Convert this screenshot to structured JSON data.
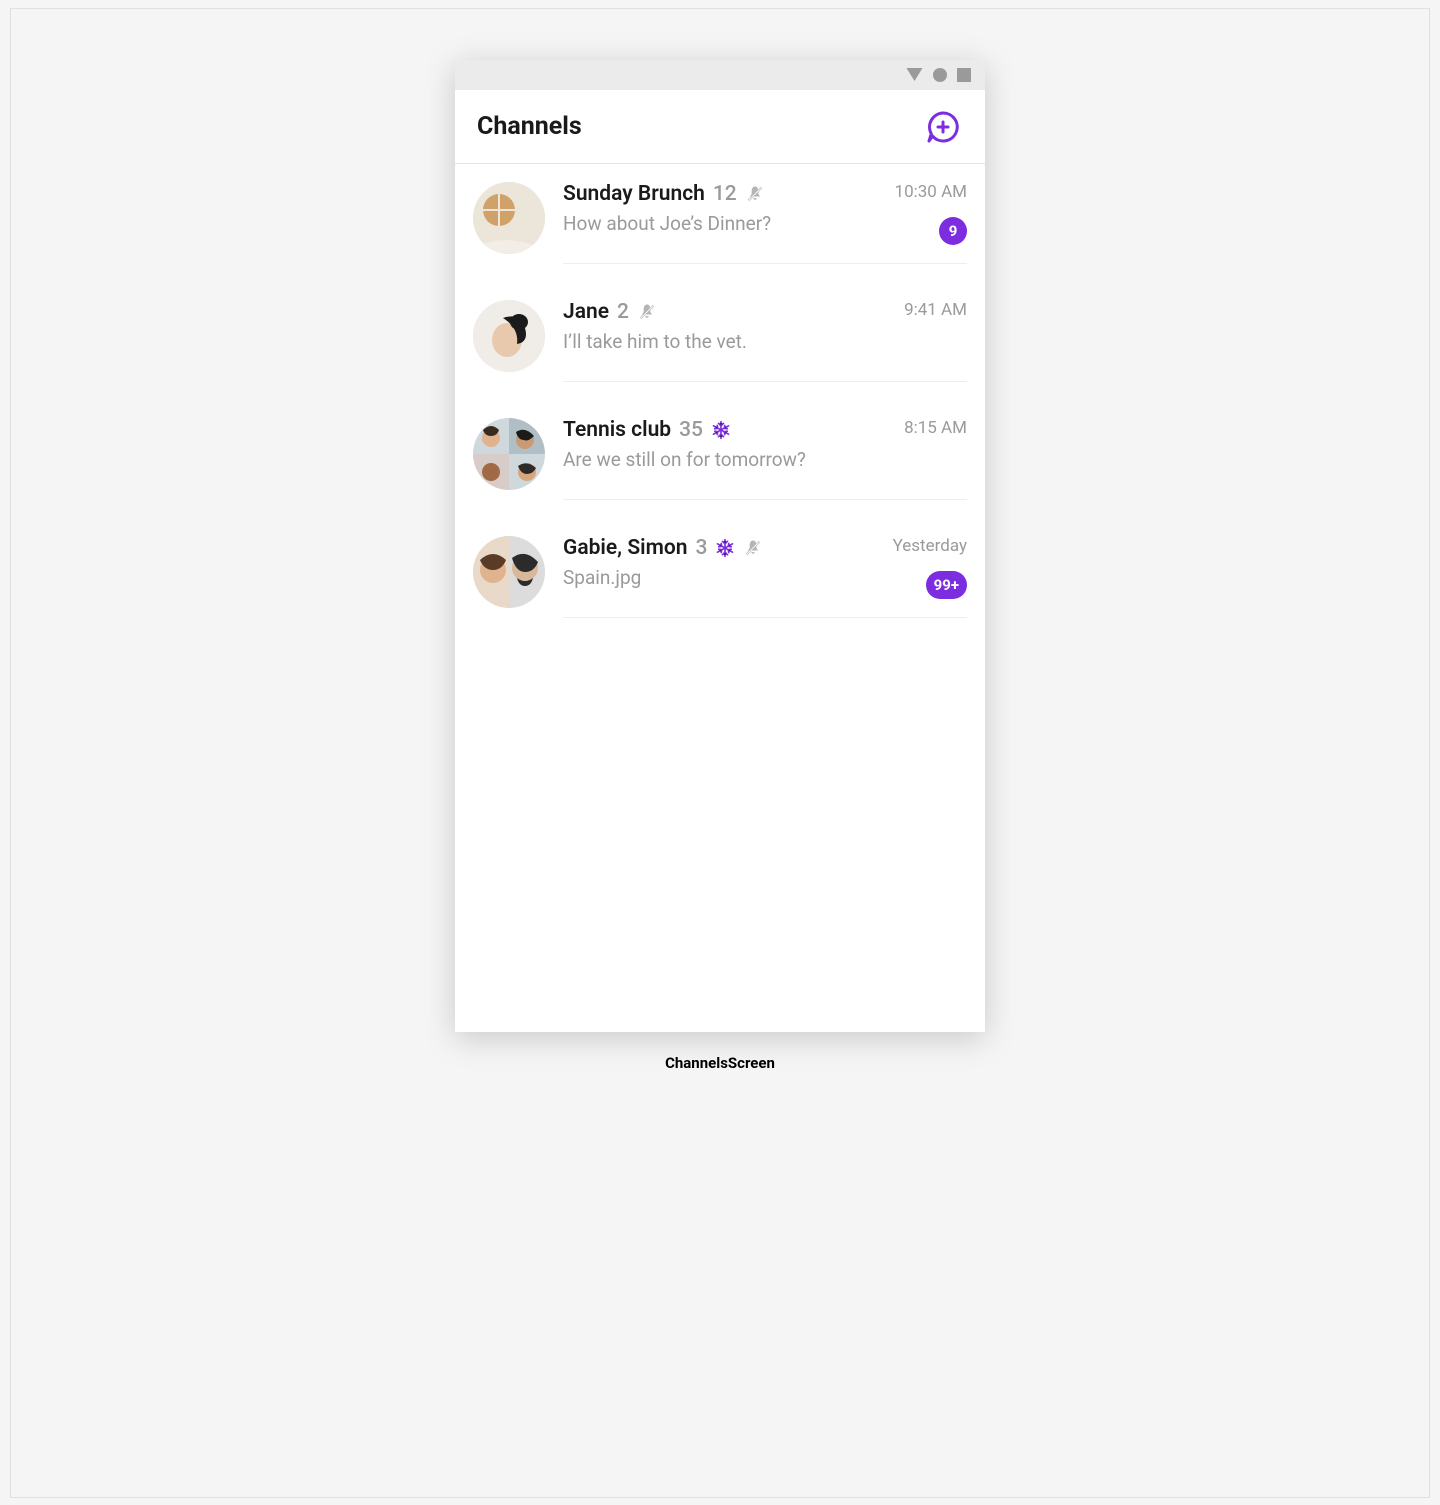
{
  "header": {
    "title": "Channels",
    "new_chat_icon": "new-chat-icon"
  },
  "colors": {
    "accent": "#7c2de0"
  },
  "channels": [
    {
      "name": "Sunday Brunch",
      "member_count": "12",
      "muted": true,
      "frozen": false,
      "preview": "How about Joe’s Dinner?",
      "timestamp": "10:30 AM",
      "unread": "9"
    },
    {
      "name": "Jane",
      "member_count": "2",
      "muted": true,
      "frozen": false,
      "preview": "I’ll take him to the vet.",
      "timestamp": "9:41 AM",
      "unread": ""
    },
    {
      "name": "Tennis club",
      "member_count": "35",
      "muted": false,
      "frozen": true,
      "preview": "Are we still on for tomorrow?",
      "timestamp": "8:15 AM",
      "unread": ""
    },
    {
      "name": "Gabie, Simon",
      "member_count": "3",
      "muted": true,
      "frozen": true,
      "preview": "Spain.jpg",
      "timestamp": "Yesterday",
      "unread": "99+"
    }
  ],
  "caption": "ChannelsScreen"
}
